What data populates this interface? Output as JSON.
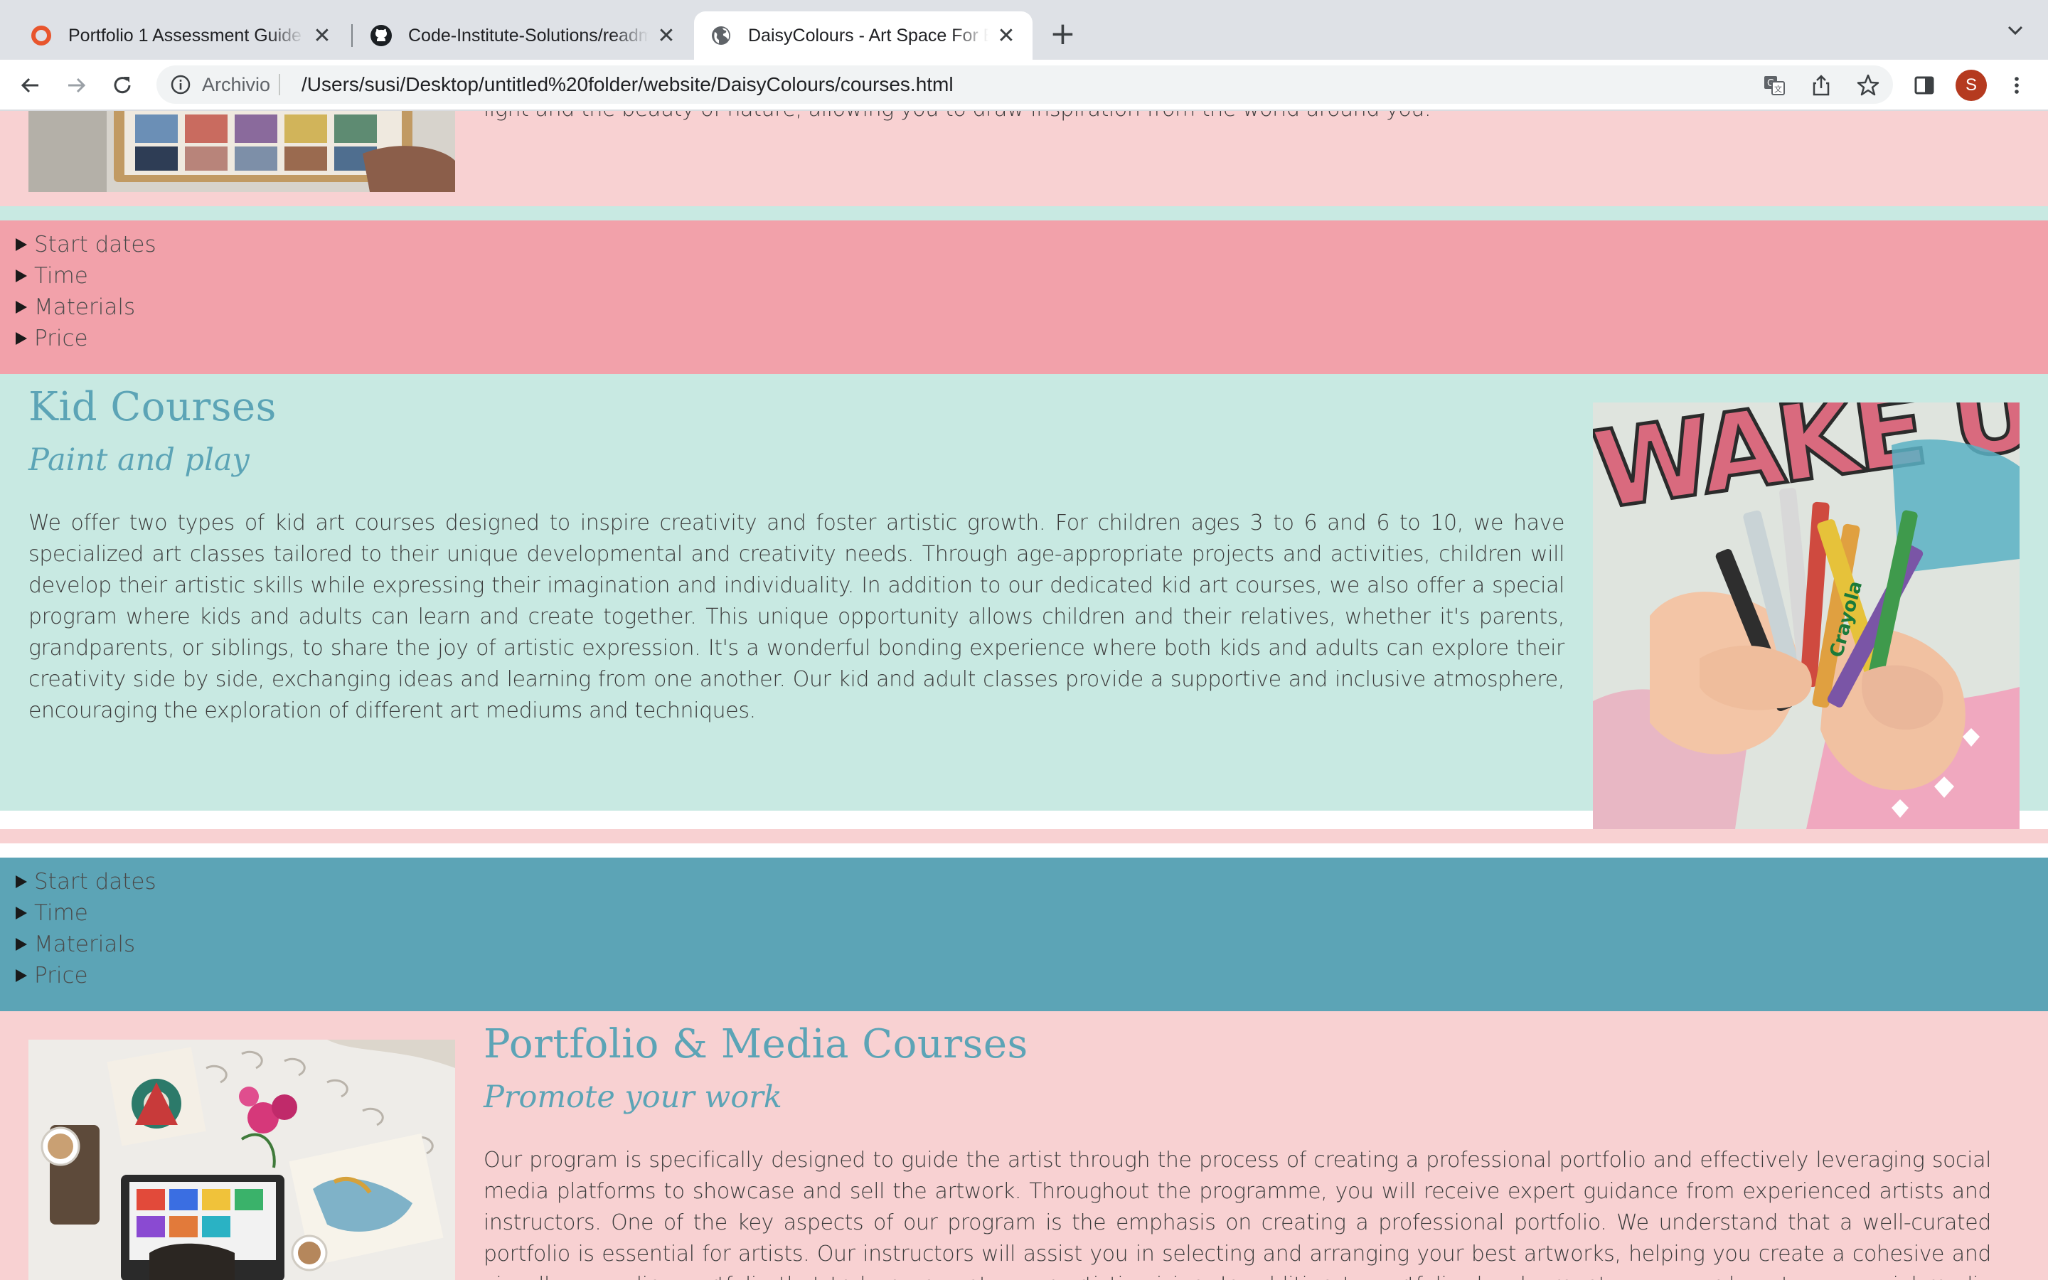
{
  "browser": {
    "tabs": [
      {
        "title": "Portfolio 1 Assessment Guide |",
        "close": "✕",
        "favicon": "orange-ring-icon"
      },
      {
        "title": "Code-Institute-Solutions/readme",
        "close": "✕",
        "favicon": "github-icon"
      },
      {
        "title": "DaisyColours - Art Space For Everyone",
        "close": "✕",
        "favicon": "globe-icon",
        "active": true
      }
    ],
    "new_tab": "+",
    "omnibox": {
      "label": "Archivio",
      "url": "/Users/susi/Desktop/untitled%20folder/website/DaisyColours/courses.html"
    },
    "profile_initial": "S",
    "colors": {
      "tab_strip": "#dee1e6",
      "omnibox": "#f1f3f4",
      "profile": "#b53a1f"
    }
  },
  "page": {
    "colors": {
      "pink": "#f8d1d2",
      "mint": "#c8e9e2",
      "rose": "#f2a1aa",
      "teal": "#5ca4b6",
      "heading": "#5ca4b6"
    },
    "top_partial_text": "light and the beauty of nature, allowing you to draw inspiration from the world around you.",
    "details_1": [
      "Start dates",
      "Time",
      "Materials",
      "Price"
    ],
    "kid": {
      "title": "Kid Courses",
      "subtitle": "Paint and play",
      "text": "We offer two types of kid art courses designed to inspire creativity and foster artistic growth. For children ages 3 to 6 and 6 to 10, we have specialized art classes tailored to their unique developmental and creativity needs. Through age-appropriate projects and activities, children will develop their artistic skills while expressing their imagination and individuality. In addition to our dedicated kid art courses, we also offer a special program where kids and adults can learn and create together. This unique opportunity allows children and their relatives, whether it's parents, grandparents, or siblings, to share the joy of artistic expression. It's a wonderful bonding experience where both kids and adults can explore their creativity side by side, exchanging ideas and learning from one another. Our kid and adult classes provide a supportive and inclusive atmosphere, encouraging the exploration of different art mediums and techniques.",
      "image_shirt_text": "WAKE UP",
      "image_crayon_brand": "Crayola"
    },
    "details_2": [
      "Start dates",
      "Time",
      "Materials",
      "Price"
    ],
    "portfolio": {
      "title": "Portfolio & Media Courses",
      "subtitle": "Promote your work",
      "text": "Our program is specifically designed to guide the artist through the process of creating a professional portfolio and effectively leveraging social media platforms to showcase and sell the artwork. Throughout the programme, you will receive expert guidance from experienced artists and instructors. One of the key aspects of our program is the emphasis on creating a professional portfolio. We understand that a well-curated portfolio is essential for artists. Our instructors will assist you in selecting and arranging your best artworks, helping you create a cohesive and visually appealing portfolio that truly represents your artistic vision. In addition to portfolio development, we cover how to use social media platforms to promote your work."
    }
  }
}
